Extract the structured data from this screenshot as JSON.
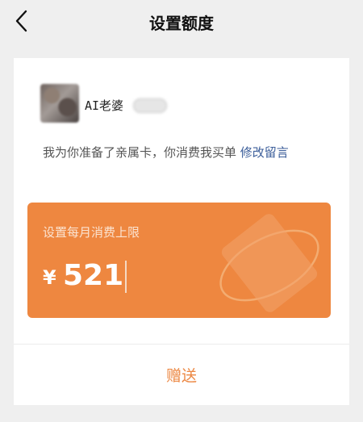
{
  "navbar": {
    "title": "设置额度",
    "back_icon": "chevron-left-icon"
  },
  "user": {
    "name": "AI老婆"
  },
  "message": {
    "text": "我为你准备了亲属卡，你消费我买单",
    "edit_link": "修改留言"
  },
  "limit": {
    "label": "设置每月消费上限",
    "currency": "¥",
    "amount": "521"
  },
  "gift_button": {
    "label": "赠送"
  },
  "colors": {
    "accent_orange": "#ee8740",
    "link_blue": "#3c5e9a",
    "background": "#efefef"
  }
}
